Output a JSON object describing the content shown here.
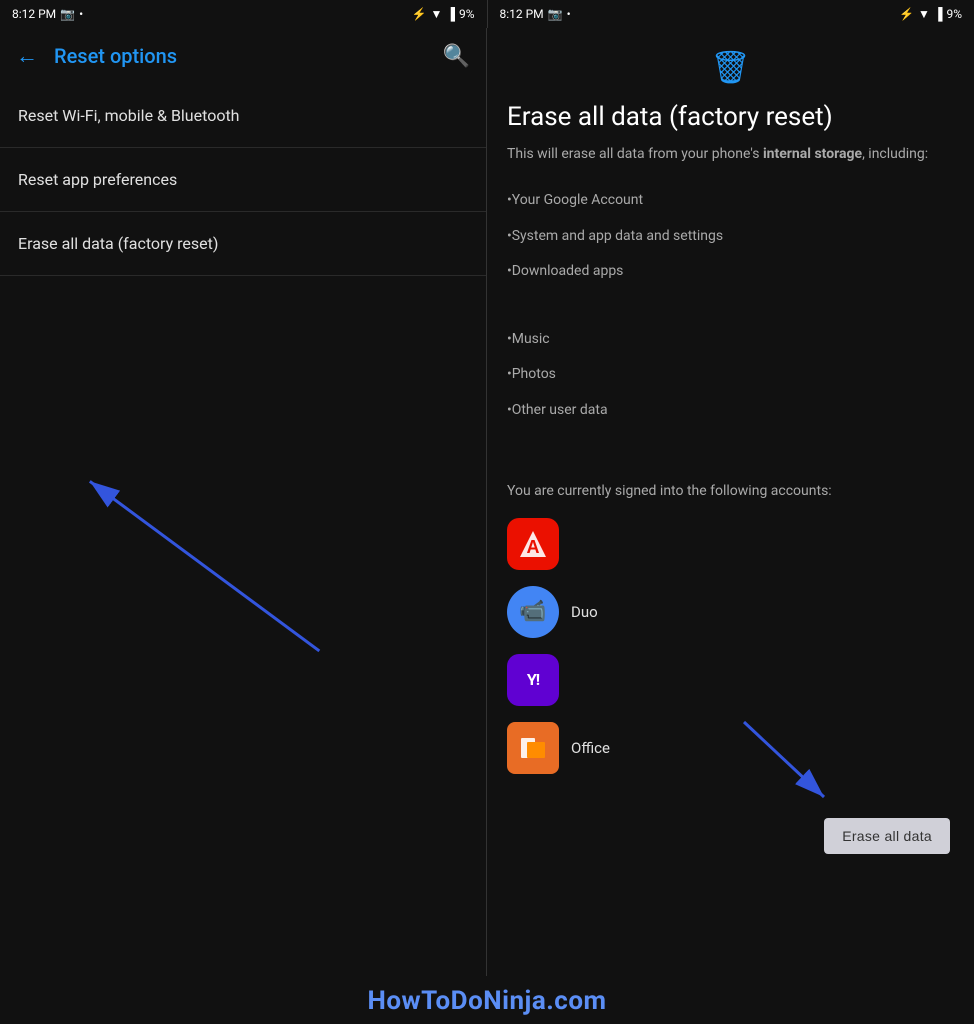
{
  "statusBar": {
    "leftTime": "8:12 PM",
    "rightTime": "8:12 PM",
    "battery": "9%"
  },
  "leftPanel": {
    "backLabel": "←",
    "title": "Reset options",
    "searchIcon": "🔍",
    "menuItems": [
      {
        "id": "wifi",
        "label": "Reset Wi-Fi, mobile & Bluetooth"
      },
      {
        "id": "app-prefs",
        "label": "Reset app preferences"
      },
      {
        "id": "factory",
        "label": "Erase all data (factory reset)"
      }
    ]
  },
  "rightPanel": {
    "trashIcon": "🗑",
    "title": "Erase all data (factory reset)",
    "description": "This will erase all data from your phone's ",
    "descriptionBold": "internal storage",
    "descriptionSuffix": ", including:",
    "listItems": [
      "•Your Google Account",
      "•System and app data and settings",
      "•Downloaded apps",
      "•Music",
      "•Photos",
      "•Other user data"
    ],
    "accountsLabel": "You are currently signed into the following accounts:",
    "accounts": [
      {
        "id": "adobe",
        "label": "",
        "color": "#eb1000",
        "icon": "A"
      },
      {
        "id": "duo",
        "label": "Duo",
        "color": "#4285F4",
        "icon": "📹"
      },
      {
        "id": "yahoo",
        "label": "",
        "color": "#6001d2",
        "icon": "Y!"
      },
      {
        "id": "office",
        "label": "Office",
        "color": "#e86c25",
        "icon": "⬛"
      }
    ],
    "eraseButton": "Erase all data"
  },
  "watermark": {
    "text": "HowToDoNinja.com"
  }
}
